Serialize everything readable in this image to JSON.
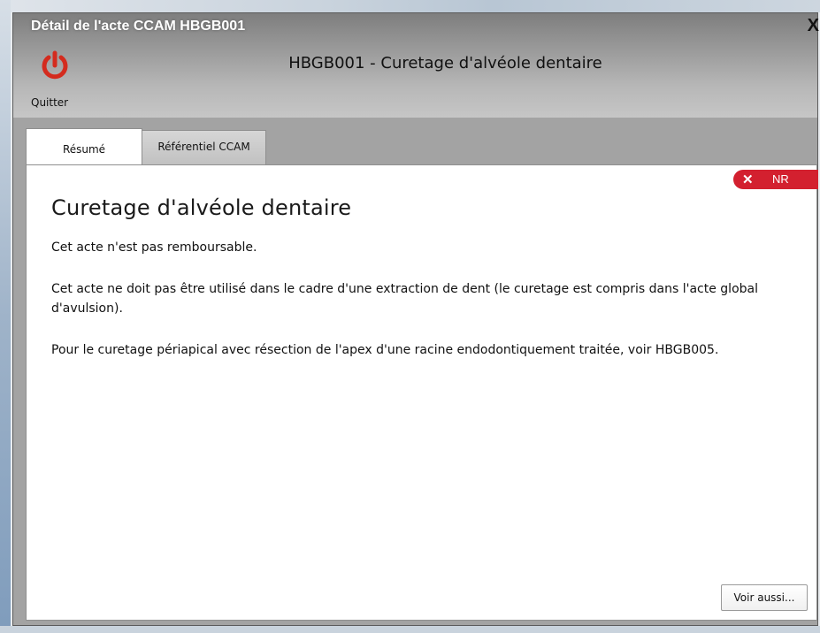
{
  "window": {
    "title": "Détail de l'acte CCAM HBGB001",
    "close_glyph": "X"
  },
  "toolbar": {
    "quit_label": "Quitter",
    "quit_icon": "power-icon",
    "quit_color": "#d42b1e"
  },
  "header": {
    "title": "HBGB001 - Curetage d'alvéole dentaire"
  },
  "tabs": [
    {
      "label": "Résumé",
      "active": true
    },
    {
      "label": "Référentiel CCAM",
      "active": false
    }
  ],
  "badge": {
    "icon": "x-icon",
    "label": "NR",
    "color": "#d3202f"
  },
  "content": {
    "title": "Curetage d'alvéole dentaire",
    "paragraphs": [
      "Cet acte n'est pas remboursable.",
      "Cet acte ne doit pas être utilisé dans le cadre d'une extraction de dent (le curetage est compris dans l'acte global d'avulsion).",
      "Pour le curetage périapical avec résection de l'apex d'une racine endodontiquement traitée, voir HBGB005."
    ],
    "see_also_label": "Voir aussi..."
  }
}
